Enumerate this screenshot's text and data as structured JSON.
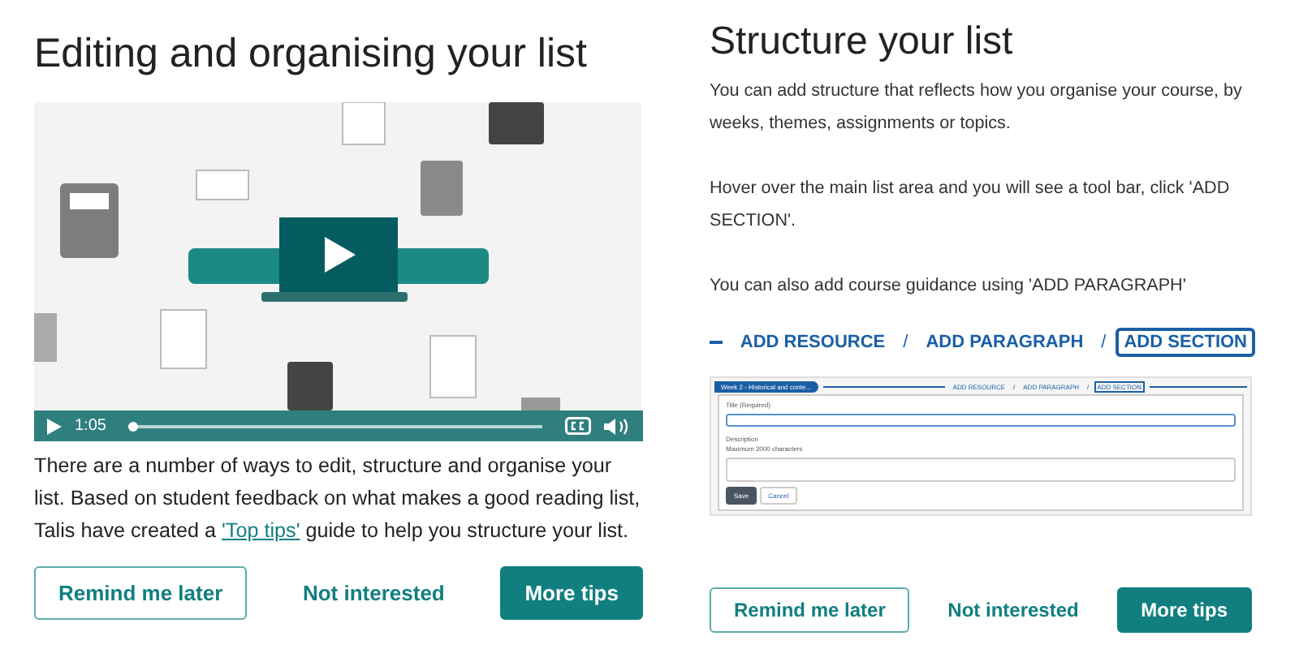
{
  "left": {
    "title": "Editing and organising your list",
    "video": {
      "time": "1:05",
      "progress": {
        "level": 0.01
      }
    },
    "text": {
      "before": "There are a number of ways to edit, structure and organise your list. Based on student feedback on what makes a good reading list, Talis have created a ",
      "link": "'Top tips'",
      "after": " guide to help you structure your list."
    },
    "buttons": [
      {
        "label": "Remind me later",
        "kind": "outline"
      },
      {
        "label": "Not interested",
        "kind": "plain"
      },
      {
        "label": "More tips",
        "kind": "primary"
      }
    ]
  },
  "right": {
    "title": "Structure your list",
    "paragraphs": [
      "You can add structure that reflects how you organise your course, by weeks, themes, assignments or topics.",
      "Hover over the main list area and you will see a tool bar, click 'ADD SECTION'.",
      "You can also add course guidance using 'ADD PARAGRAPH'"
    ],
    "toolbar": [
      {
        "label": "ADD RESOURCE",
        "selected": false
      },
      {
        "label": "ADD PARAGRAPH",
        "selected": false
      },
      {
        "label": "ADD SECTION",
        "selected": true
      }
    ],
    "toolbar_separator": "/",
    "screenshot": {
      "section_tag": "Week 2 - Historical and conte...",
      "toolbar": [
        {
          "label": "ADD RESOURCE",
          "selected": false
        },
        {
          "label": "ADD PARAGRAPH",
          "selected": false
        },
        {
          "label": "ADD SECTION",
          "selected": true
        }
      ],
      "fields": [
        {
          "kind": "input",
          "label": "Title (Required)"
        },
        {
          "kind": "textarea",
          "label": "Description",
          "hint": "Maximum 2000 characters"
        }
      ],
      "buttons": [
        {
          "label": "Save",
          "kind": "primary"
        },
        {
          "label": "Cancel",
          "kind": "outline"
        }
      ]
    },
    "buttons": [
      {
        "label": "Remind me later",
        "kind": "outline"
      },
      {
        "label": "Not interested",
        "kind": "plain"
      },
      {
        "label": "More tips",
        "kind": "primary"
      }
    ]
  }
}
